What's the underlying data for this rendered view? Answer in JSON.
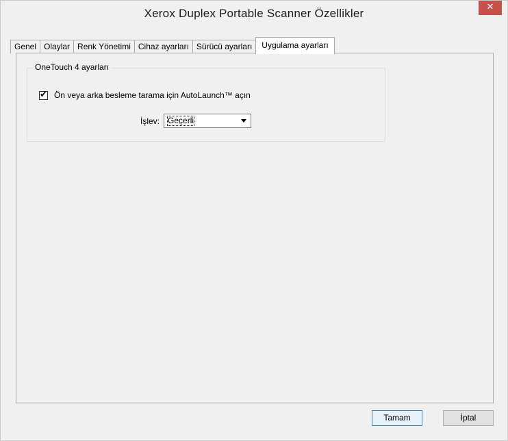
{
  "window": {
    "title": "Xerox Duplex Portable Scanner Özellikler",
    "close_glyph": "✕"
  },
  "tabs": [
    {
      "label": "Genel"
    },
    {
      "label": "Olaylar"
    },
    {
      "label": "Renk Yönetimi"
    },
    {
      "label": "Cihaz ayarları"
    },
    {
      "label": "Sürücü ayarları"
    },
    {
      "label": "Uygulama ayarları"
    }
  ],
  "active_tab": "Uygulama ayarları",
  "group": {
    "legend": "OneTouch 4 ayarları",
    "checkbox": {
      "label": "Ön veya arka besleme tarama için AutoLaunch™ açın",
      "checked": true
    },
    "function": {
      "label": "İşlev:",
      "selected": "Geçerli"
    }
  },
  "buttons": {
    "ok_label": "Tamam",
    "cancel_label": "İptal"
  },
  "colors": {
    "close_button": "#c7504b",
    "default_button_border": "#3c7fb1"
  }
}
